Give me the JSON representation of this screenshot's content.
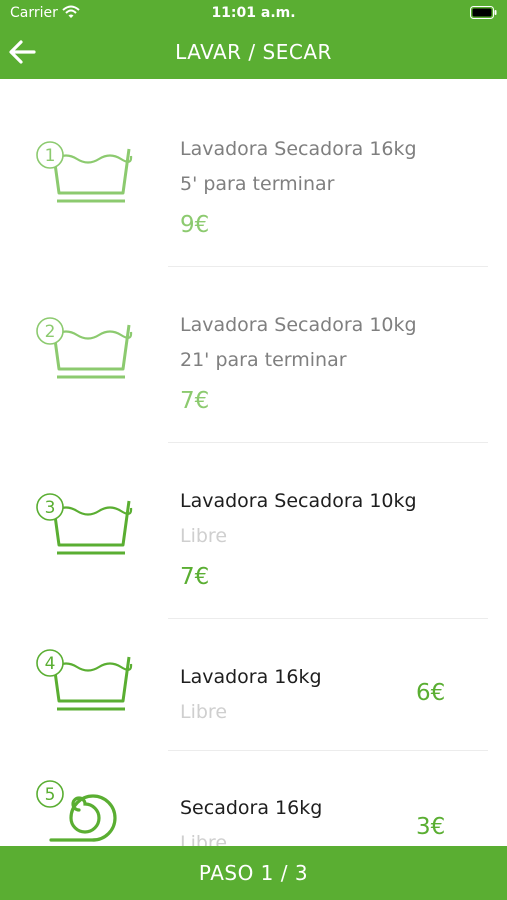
{
  "status_bar": {
    "carrier": "Carrier",
    "time": "11:01 a.m."
  },
  "header": {
    "title": "LAVAR / SECAR"
  },
  "icons": {
    "back": "arrow-left-icon",
    "wash": "wash-tub-icon",
    "dry": "dryer-spiral-icon"
  },
  "colors": {
    "brand": "#5aae32",
    "busy_price": "#8cca6f",
    "busy_text": "#7f7f7f",
    "free_status": "#cfcfcf"
  },
  "machines": [
    {
      "number": "1",
      "name": "Lavadora Secadora 16kg",
      "status": "5' para terminar",
      "price": "9€",
      "type": "wash",
      "state": "busy"
    },
    {
      "number": "2",
      "name": "Lavadora Secadora 10kg",
      "status": "21' para terminar",
      "price": "7€",
      "type": "wash",
      "state": "busy"
    },
    {
      "number": "3",
      "name": "Lavadora Secadora 10kg",
      "status": "Libre",
      "price": "7€",
      "type": "wash",
      "state": "free"
    },
    {
      "number": "4",
      "name": "Lavadora 16kg",
      "status": "Libre",
      "price": "6€",
      "type": "wash",
      "state": "free"
    },
    {
      "number": "5",
      "name": "Secadora 16kg",
      "status": "Libre",
      "price": "3€",
      "type": "dry",
      "state": "free"
    }
  ],
  "footer": {
    "label": "PASO 1 / 3"
  }
}
